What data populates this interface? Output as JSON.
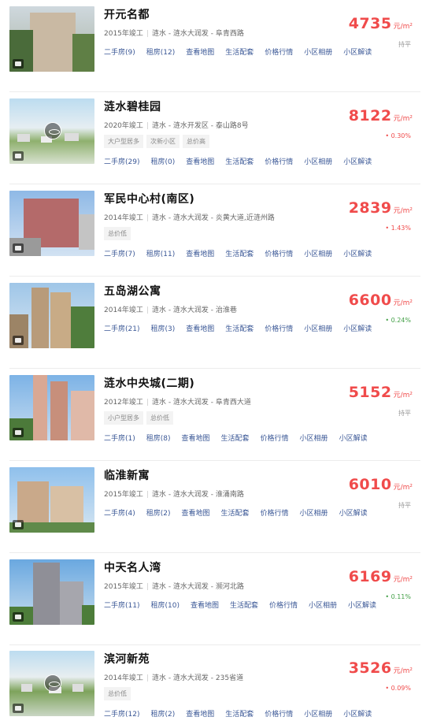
{
  "listings": [
    {
      "name": "开元名都",
      "year": "2015年竣工",
      "location": "涟水 - 涟水大润发 - 阜青西路",
      "tags": [],
      "links": [
        "二手房(9)",
        "租房(12)",
        "查看地图",
        "生活配套",
        "价格行情",
        "小区相册",
        "小区解读"
      ],
      "price": "4735",
      "unit": "元/m²",
      "trend": "持平",
      "trend_dir": "flat"
    },
    {
      "name": "涟水碧桂园",
      "year": "2020年竣工",
      "location": "涟水 - 涟水开发区 - 泰山路8号",
      "tags": [
        "大户型居多",
        "次新小区",
        "总价高"
      ],
      "links": [
        "二手房(29)",
        "租房(0)",
        "查看地图",
        "生活配套",
        "价格行情",
        "小区相册",
        "小区解读"
      ],
      "price": "8122",
      "unit": "元/m²",
      "trend": "• 0.30%",
      "trend_dir": "up"
    },
    {
      "name": "军民中心村(南区)",
      "year": "2014年竣工",
      "location": "涟水 - 涟水大润发 - 炎黄大道,近涟州路",
      "tags": [
        "总价低"
      ],
      "links": [
        "二手房(7)",
        "租房(11)",
        "查看地图",
        "生活配套",
        "价格行情",
        "小区相册",
        "小区解读"
      ],
      "price": "2839",
      "unit": "元/m²",
      "trend": "• 1.43%",
      "trend_dir": "up"
    },
    {
      "name": "五岛湖公寓",
      "year": "2014年竣工",
      "location": "涟水 - 涟水大润发 - 治淮巷",
      "tags": [],
      "links": [
        "二手房(21)",
        "租房(3)",
        "查看地图",
        "生活配套",
        "价格行情",
        "小区相册",
        "小区解读"
      ],
      "price": "6600",
      "unit": "元/m²",
      "trend": "• 0.24%",
      "trend_dir": "down"
    },
    {
      "name": "涟水中央城(二期)",
      "year": "2012年竣工",
      "location": "涟水 - 涟水大润发 - 阜青西大道",
      "tags": [
        "小户型居多",
        "总价低"
      ],
      "links": [
        "二手房(1)",
        "租房(8)",
        "查看地图",
        "生活配套",
        "价格行情",
        "小区相册",
        "小区解读"
      ],
      "price": "5152",
      "unit": "元/m²",
      "trend": "持平",
      "trend_dir": "flat"
    },
    {
      "name": "临淮新寓",
      "year": "2015年竣工",
      "location": "涟水 - 涟水大润发 - 淮涌南路",
      "tags": [],
      "links": [
        "二手房(4)",
        "租房(2)",
        "查看地图",
        "生活配套",
        "价格行情",
        "小区相册",
        "小区解读"
      ],
      "price": "6010",
      "unit": "元/m²",
      "trend": "持平",
      "trend_dir": "flat"
    },
    {
      "name": "中天名人湾",
      "year": "2015年竣工",
      "location": "涟水 - 涟水大润发 - 濒河北路",
      "tags": [],
      "links": [
        "二手房(11)",
        "租房(10)",
        "查看地图",
        "生活配套",
        "价格行情",
        "小区相册",
        "小区解读"
      ],
      "price": "6169",
      "unit": "元/m²",
      "trend": "• 0.11%",
      "trend_dir": "down"
    },
    {
      "name": "滨河新苑",
      "year": "2014年竣工",
      "location": "涟水 - 涟水大润发 - 235省道",
      "tags": [
        "总价低"
      ],
      "links": [
        "二手房(12)",
        "租房(2)",
        "查看地图",
        "生活配套",
        "价格行情",
        "小区相册",
        "小区解读"
      ],
      "price": "3526",
      "unit": "元/m²",
      "trend": "• 0.09%",
      "trend_dir": "up"
    }
  ],
  "colors": {
    "price": "#f04b4b",
    "link": "#3a5796",
    "trend_up": "#f04b4b",
    "trend_down": "#43a047",
    "trend_flat": "#999999"
  }
}
